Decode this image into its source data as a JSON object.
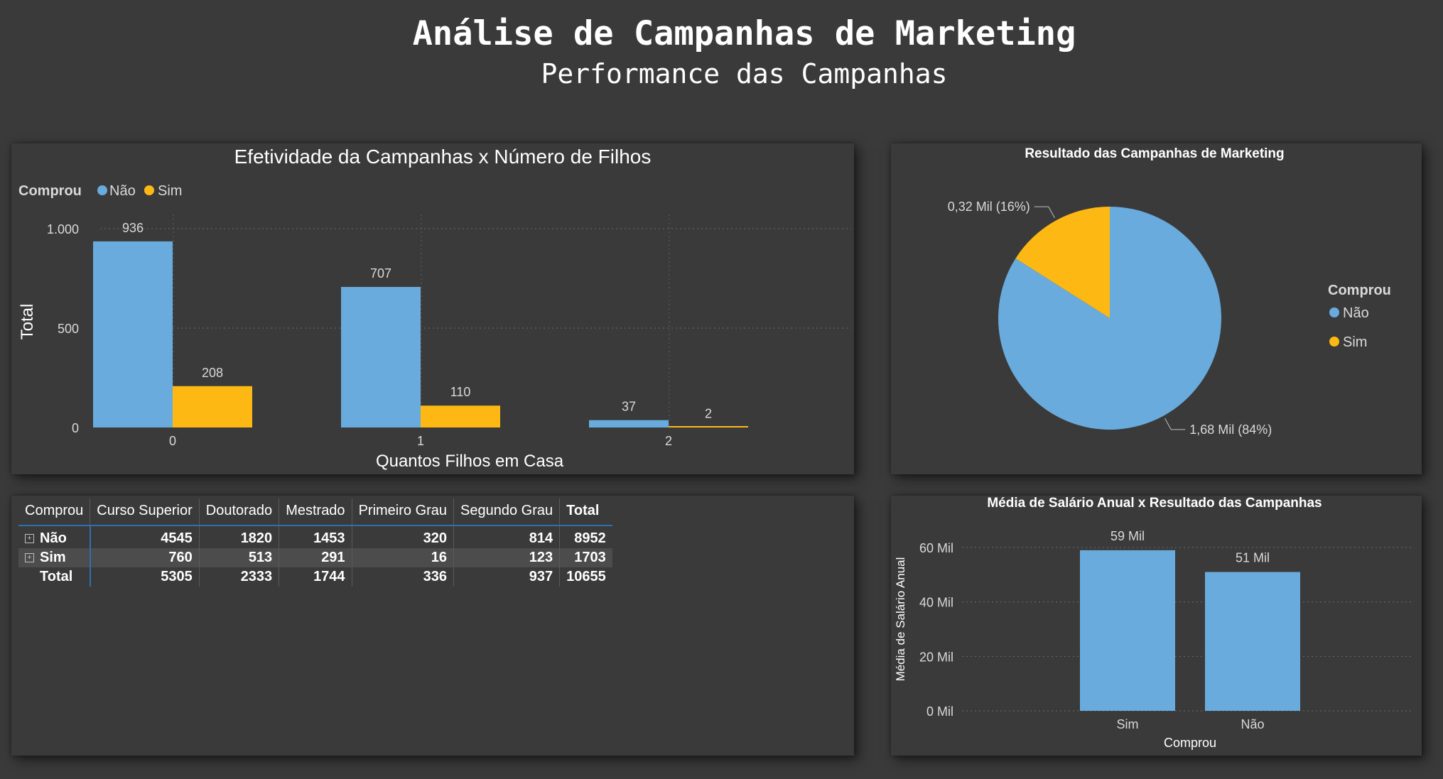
{
  "header": {
    "title": "Análise de Campanhas de Marketing",
    "subtitle": "Performance das Campanhas"
  },
  "colors": {
    "nao": "#69abdd",
    "sim": "#fdb813",
    "background": "#3a3a3a"
  },
  "chart_data": [
    {
      "type": "bar",
      "title": "Efetividade da Campanhas x Número de Filhos",
      "legend_title": "Comprou",
      "legend_position": "top-left",
      "categories": [
        "0",
        "1",
        "2"
      ],
      "series": [
        {
          "name": "Não",
          "values": [
            936,
            707,
            37
          ]
        },
        {
          "name": "Sim",
          "values": [
            208,
            110,
            2
          ]
        }
      ],
      "data_labels": [
        [
          "936",
          "707",
          "37"
        ],
        [
          "208",
          "110",
          "2"
        ]
      ],
      "xlabel": "Quantos Filhos em Casa",
      "ylabel": "Total",
      "ylim": [
        0,
        1000
      ],
      "yticks": [
        0,
        500,
        1000
      ],
      "ytick_labels": [
        "0",
        "500",
        "1.000"
      ],
      "grid": true
    },
    {
      "type": "pie",
      "title": "Resultado das Campanhas de Marketing",
      "legend_title": "Comprou",
      "legend_position": "right",
      "slices": [
        {
          "name": "Não",
          "value": 1.68,
          "percent": 84,
          "label": "1,68 Mil (84%)"
        },
        {
          "name": "Sim",
          "value": 0.32,
          "percent": 16,
          "label": "0,32 Mil (16%)"
        }
      ]
    },
    {
      "type": "table",
      "headers": [
        "Comprou",
        "Curso Superior",
        "Doutorado",
        "Mestrado",
        "Primeiro Grau",
        "Segundo Grau",
        "Total"
      ],
      "rows": [
        {
          "label": "Não",
          "expandable": true,
          "values": [
            "4545",
            "1820",
            "1453",
            "320",
            "814",
            "8952"
          ]
        },
        {
          "label": "Sim",
          "expandable": true,
          "values": [
            "760",
            "513",
            "291",
            "16",
            "123",
            "1703"
          ]
        },
        {
          "label": "Total",
          "expandable": false,
          "values": [
            "5305",
            "2333",
            "1744",
            "336",
            "937",
            "10655"
          ]
        }
      ]
    },
    {
      "type": "bar",
      "title": "Média de Salário Anual x Resultado das Campanhas",
      "categories": [
        "Sim",
        "Não"
      ],
      "values": [
        59,
        51
      ],
      "value_unit": "Mil",
      "data_labels": [
        "59 Mil",
        "51 Mil"
      ],
      "xlabel": "Comprou",
      "ylabel": "Média de Salário Anual",
      "ylim": [
        0,
        60
      ],
      "yticks": [
        0,
        20,
        40,
        60
      ],
      "ytick_labels": [
        "0 Mil",
        "20 Mil",
        "40 Mil",
        "60 Mil"
      ],
      "grid": true
    }
  ]
}
